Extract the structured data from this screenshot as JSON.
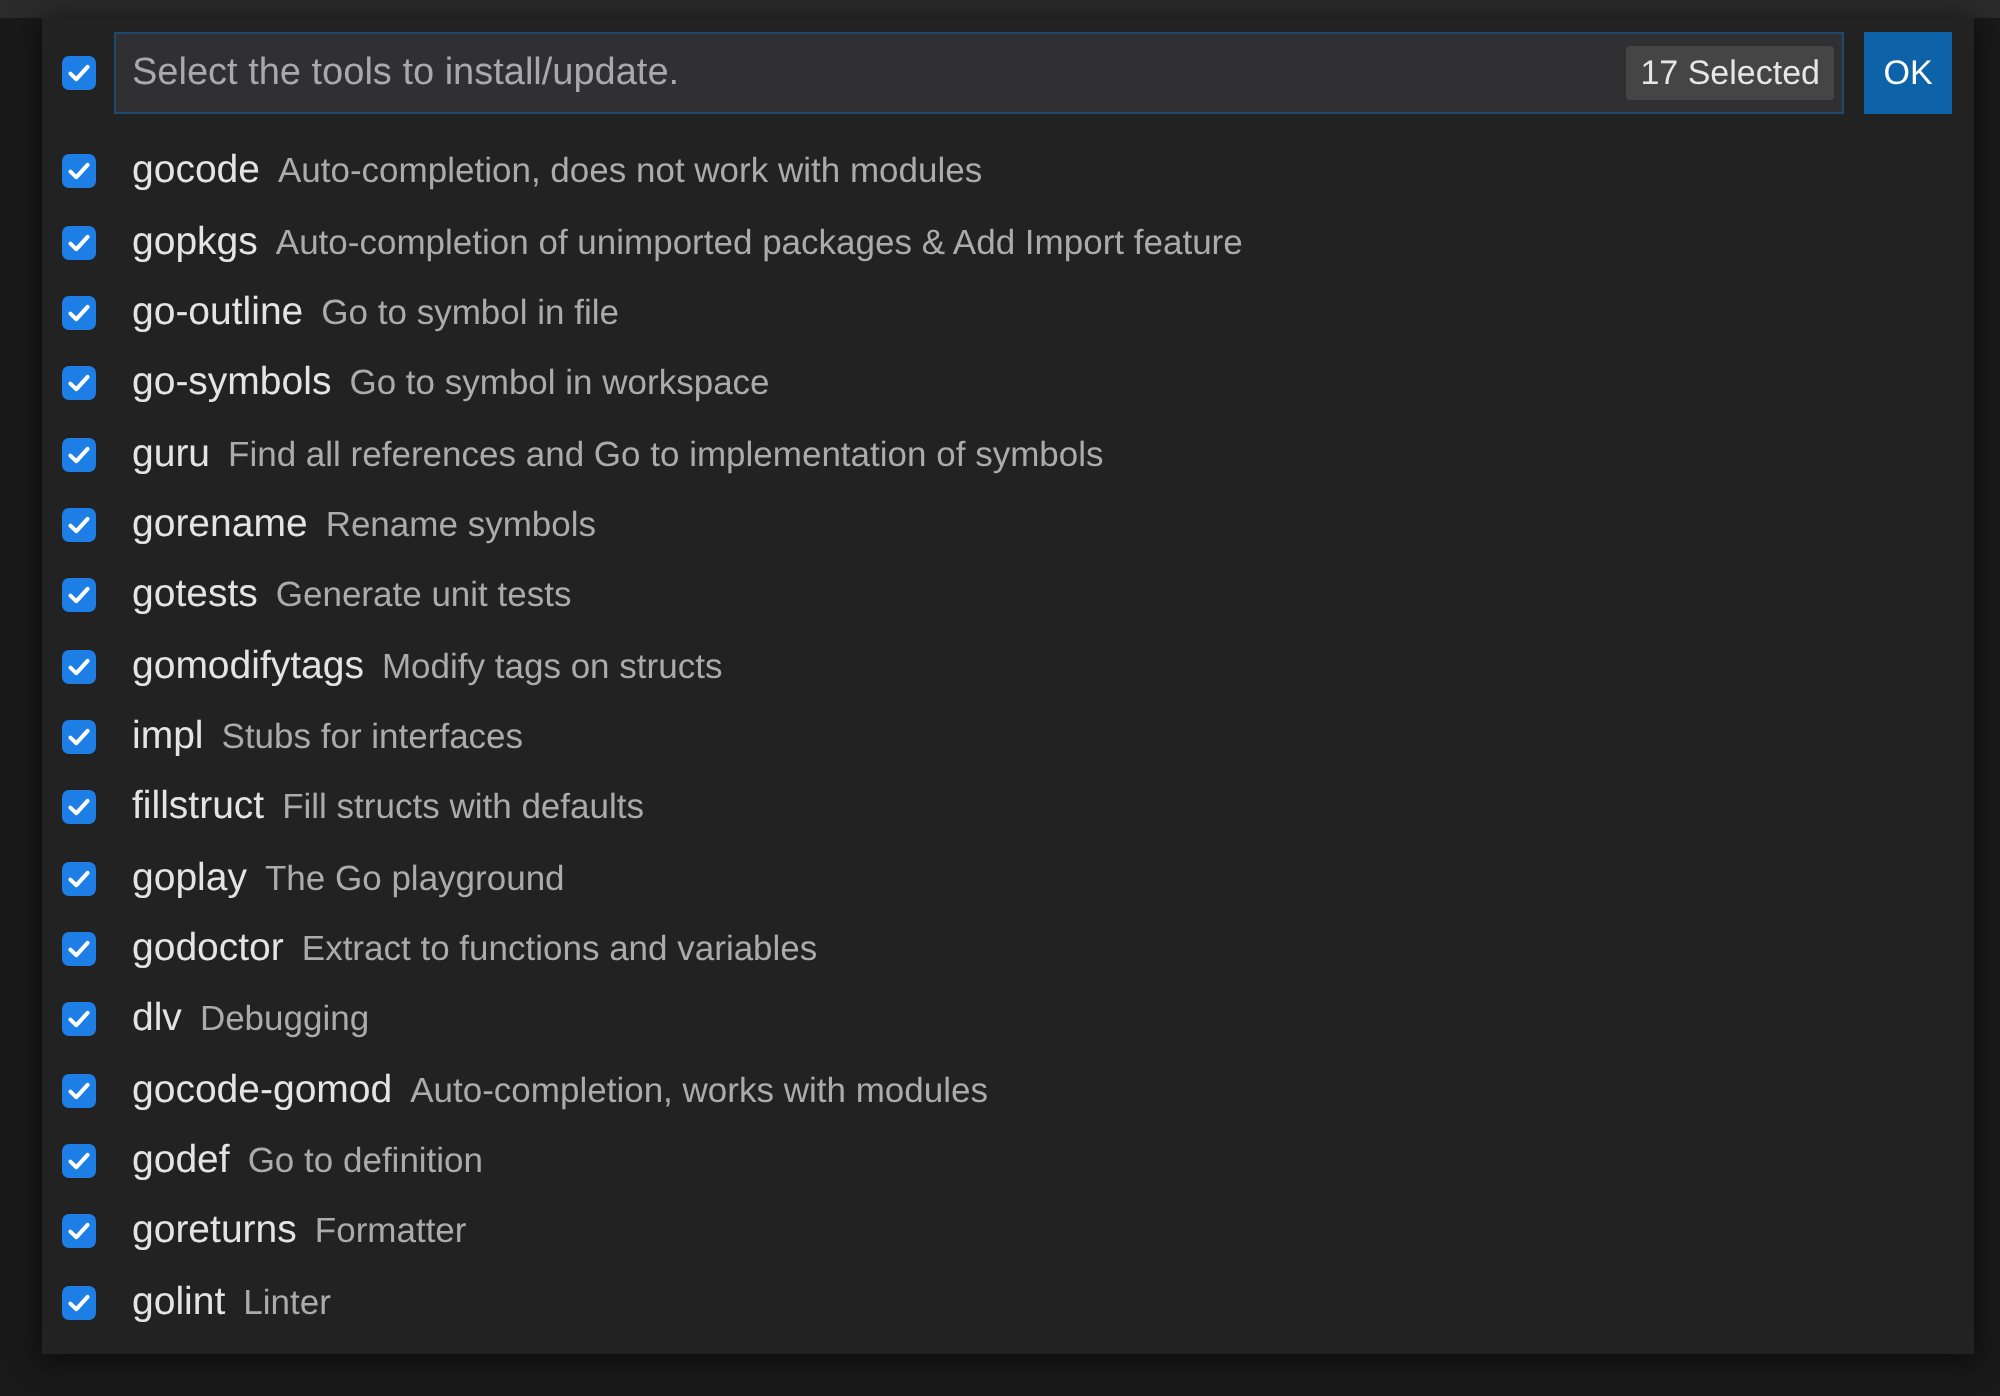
{
  "header": {
    "select_all": {
      "checked": true
    },
    "input": {
      "placeholder": "Select the tools to install/update."
    },
    "count_badge": "17 Selected",
    "ok_button": "OK"
  },
  "tools": [
    {
      "name": "gocode",
      "description": "Auto-completion, does not work with modules",
      "checked": true
    },
    {
      "name": "gopkgs",
      "description": "Auto-completion of unimported packages & Add Import feature",
      "checked": true
    },
    {
      "name": "go-outline",
      "description": "Go to symbol in file",
      "checked": true
    },
    {
      "name": "go-symbols",
      "description": "Go to symbol in workspace",
      "checked": true
    },
    {
      "name": "guru",
      "description": "Find all references and Go to implementation of symbols",
      "checked": true
    },
    {
      "name": "gorename",
      "description": "Rename symbols",
      "checked": true
    },
    {
      "name": "gotests",
      "description": "Generate unit tests",
      "checked": true
    },
    {
      "name": "gomodifytags",
      "description": "Modify tags on structs",
      "checked": true
    },
    {
      "name": "impl",
      "description": "Stubs for interfaces",
      "checked": true
    },
    {
      "name": "fillstruct",
      "description": "Fill structs with defaults",
      "checked": true
    },
    {
      "name": "goplay",
      "description": "The Go playground",
      "checked": true
    },
    {
      "name": "godoctor",
      "description": "Extract to functions and variables",
      "checked": true
    },
    {
      "name": "dlv",
      "description": "Debugging",
      "checked": true
    },
    {
      "name": "gocode-gomod",
      "description": "Auto-completion, works with modules",
      "checked": true
    },
    {
      "name": "godef",
      "description": "Go to definition",
      "checked": true
    },
    {
      "name": "goreturns",
      "description": "Formatter",
      "checked": true
    },
    {
      "name": "golint",
      "description": "Linter",
      "checked": true
    }
  ]
}
